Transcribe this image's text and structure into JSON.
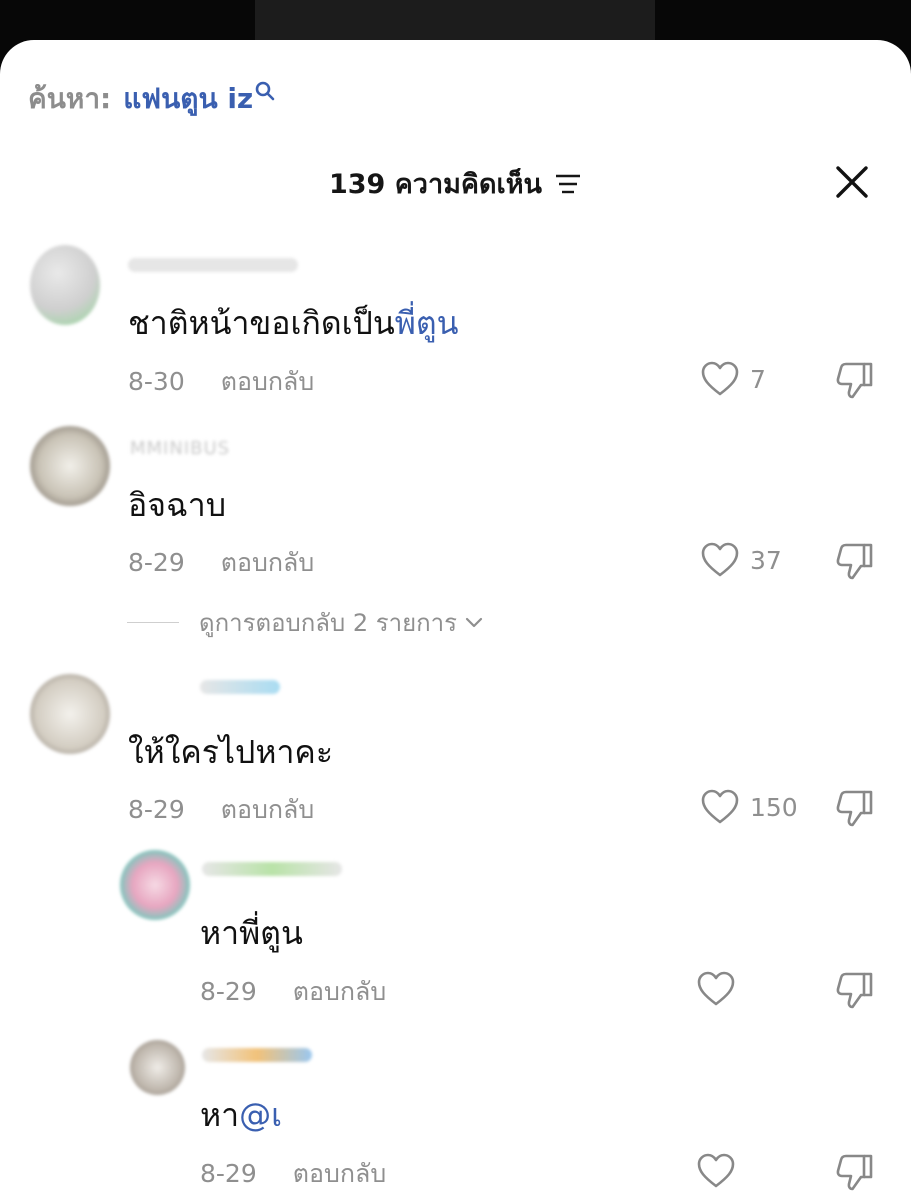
{
  "search": {
    "prefix": "ค้นหา:",
    "term": "แฟนตูน iz"
  },
  "header": {
    "count_title": "139 ความคิดเห็น"
  },
  "reply_label": "ตอบกลับ",
  "comments": [
    {
      "username": "",
      "text": "ชาติหน้าขอเกิดเป็น",
      "mention": "พี่ตูน",
      "date": "8-30",
      "likes": "7"
    },
    {
      "username": "MMINIBUS",
      "text": "อิจฉาบ",
      "date": "8-29",
      "likes": "37",
      "view_replies": "ดูการตอบกลับ 2 รายการ"
    },
    {
      "username": "",
      "text": "ให้ใครไปหาคะ",
      "date": "8-29",
      "likes": "150"
    }
  ],
  "replies": [
    {
      "username": "",
      "text": "หาพี่ตูน",
      "date": "8-29",
      "likes": ""
    },
    {
      "username": "",
      "text": "หา",
      "mention": "@เ",
      "date": "8-29",
      "likes": ""
    }
  ],
  "colors": {
    "accent_link": "#3a5fb0",
    "muted_text": "#8f8f8f",
    "sheet_bg": "#ffffff"
  }
}
